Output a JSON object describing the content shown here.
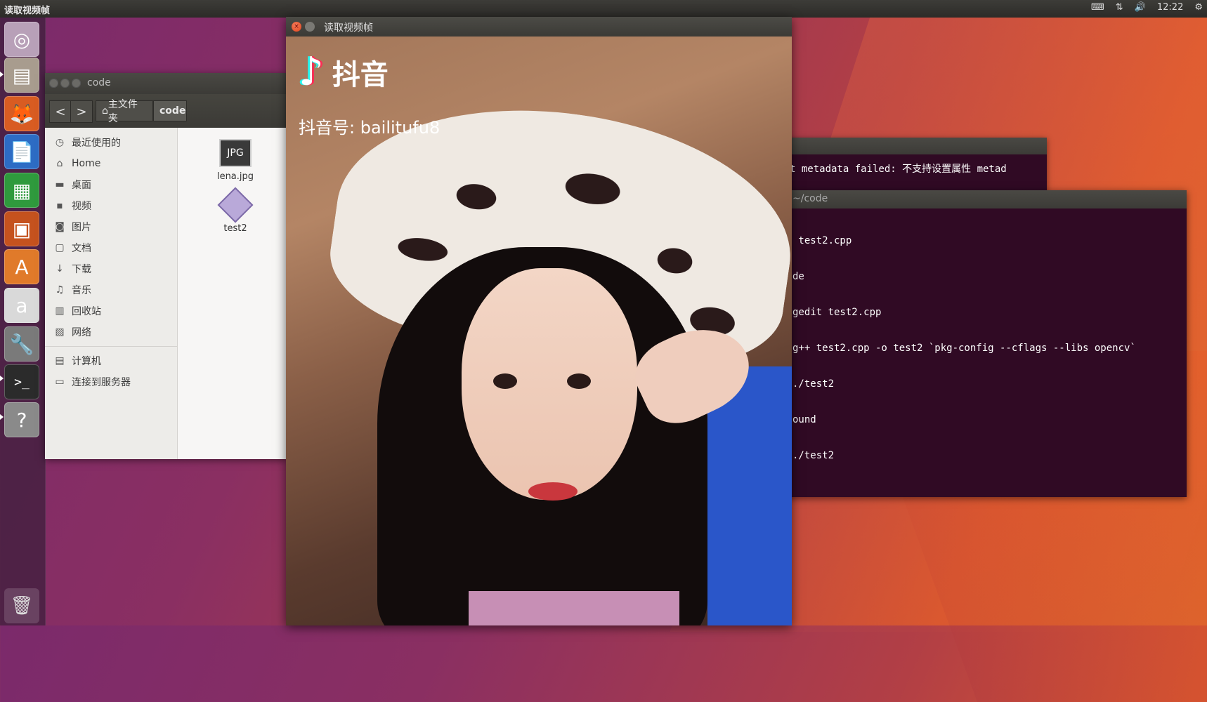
{
  "topbar": {
    "active_window_title": "读取视频帧",
    "clock": "12:22",
    "keyboard_icon": "⌨",
    "network_icon": "⇅",
    "volume_icon": "🔊",
    "settings_icon": "⚙"
  },
  "launcher": {
    "items": [
      {
        "name": "ubuntu-dash",
        "glyph": "◎",
        "color": "#b8a0b8"
      },
      {
        "name": "files",
        "glyph": "▤",
        "color": "#a89c8e"
      },
      {
        "name": "firefox",
        "glyph": "🦊",
        "color": "#d85c22"
      },
      {
        "name": "writer",
        "glyph": "📄",
        "color": "#2d6cc4"
      },
      {
        "name": "calc",
        "glyph": "▦",
        "color": "#2f9a3d"
      },
      {
        "name": "impress",
        "glyph": "▣",
        "color": "#c5521e"
      },
      {
        "name": "software-center",
        "glyph": "A",
        "color": "#e07a2a"
      },
      {
        "name": "amazon",
        "glyph": "a",
        "color": "#d9d9d9"
      },
      {
        "name": "system-settings",
        "glyph": "🔧",
        "color": "#7a7a7a"
      },
      {
        "name": "terminal",
        "glyph": ">_",
        "color": "#2b2b2b"
      },
      {
        "name": "help",
        "glyph": "?",
        "color": "#8a8a8a"
      }
    ],
    "trash_glyph": "🗑"
  },
  "file_manager": {
    "title": "code",
    "back_glyph": "<",
    "forward_glyph": ">",
    "breadcrumb_home": "主文件夹",
    "breadcrumb_current": "code",
    "sidebar": [
      {
        "icon": "◷",
        "label": "最近使用的"
      },
      {
        "icon": "⌂",
        "label": "Home"
      },
      {
        "icon": "▬",
        "label": "桌面"
      },
      {
        "icon": "▪",
        "label": "视频"
      },
      {
        "icon": "◙",
        "label": "图片"
      },
      {
        "icon": "▢",
        "label": "文档"
      },
      {
        "icon": "↓",
        "label": "下载"
      },
      {
        "icon": "♫",
        "label": "音乐"
      },
      {
        "icon": "▥",
        "label": "回收站"
      },
      {
        "icon": "▨",
        "label": "网络"
      }
    ],
    "sidebar_devices": [
      {
        "icon": "▤",
        "label": "计算机"
      },
      {
        "icon": "▭",
        "label": "连接到服务器"
      }
    ],
    "files": [
      {
        "name": "lena.jpg",
        "badge": "JPG"
      },
      {
        "name": "test2",
        "badge": ""
      }
    ]
  },
  "terminal_back": {
    "line": "t metadata failed: 不支持设置属性 metad"
  },
  "terminal_front": {
    "title": "~/code",
    "lines": [
      " test2.cpp",
      "de",
      "gedit test2.cpp",
      "g++ test2.cpp -o test2 `pkg-config --cflags --libs opencv`",
      "./test2",
      "ound",
      "./test2"
    ]
  },
  "video_window": {
    "title": "读取视频帧",
    "close_glyph": "×",
    "overlay_logo_glyph": "♪",
    "overlay_brand": "抖音",
    "overlay_id": "抖音号: bailitufu8"
  }
}
